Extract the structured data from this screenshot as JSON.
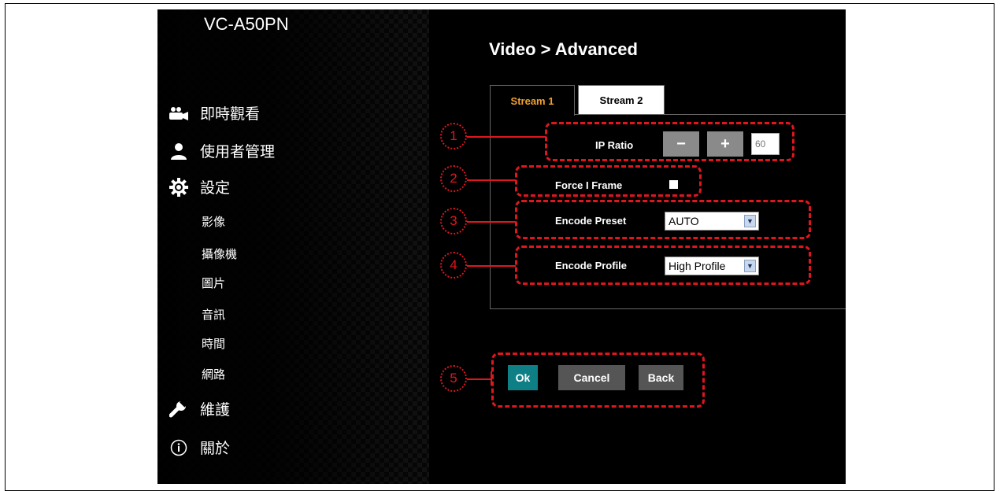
{
  "device_name": "VC-A50PN",
  "page_title": "Video > Advanced",
  "nav": {
    "live_view": "即時觀看",
    "user_mgmt": "使用者管理",
    "settings": "設定",
    "sub_items": [
      "影像",
      "攝像機",
      "圖片",
      "音訊",
      "時間",
      "網路"
    ],
    "maintenance": "維護",
    "about": "關於"
  },
  "tabs": [
    "Stream 1",
    "Stream 2"
  ],
  "form": {
    "ip_ratio_label": "IP Ratio",
    "ip_ratio_minus": "−",
    "ip_ratio_plus": "+",
    "ip_ratio_value": "60",
    "force_i_frame_label": "Force I Frame",
    "force_i_frame_checked": false,
    "encode_preset_label": "Encode Preset",
    "encode_preset_value": "AUTO",
    "encode_profile_label": "Encode Profile",
    "encode_profile_value": "High Profile"
  },
  "buttons": {
    "ok": "Ok",
    "cancel": "Cancel",
    "back": "Back"
  },
  "callouts": [
    "1",
    "2",
    "3",
    "4",
    "5"
  ],
  "colors": {
    "annotation": "#e0161e",
    "ok_button": "#0f7f86",
    "button_gray": "#555555",
    "active_tab": "#f0a030"
  }
}
